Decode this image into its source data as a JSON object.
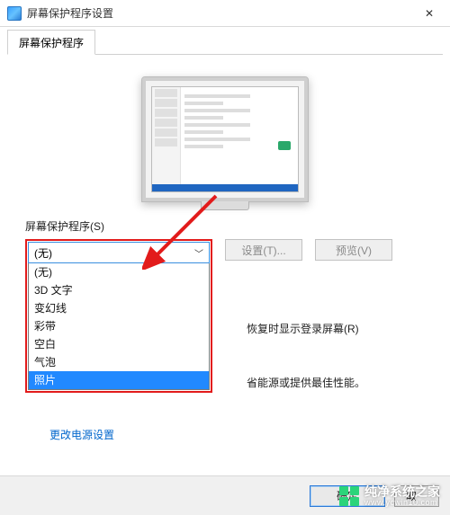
{
  "window": {
    "title": "屏幕保护程序设置",
    "close": "✕"
  },
  "tab": {
    "label": "屏幕保护程序"
  },
  "section_label": "屏幕保护程序(S)",
  "combo": {
    "selected": "(无)",
    "options": [
      "(无)",
      "3D 文字",
      "变幻线",
      "彩带",
      "空白",
      "气泡",
      "照片"
    ]
  },
  "buttons": {
    "settings": "设置(T)...",
    "preview": "预览(V)"
  },
  "partial": {
    "resume": "恢复时显示登录屏幕(R)",
    "power": "省能源或提供最佳性能。"
  },
  "link": {
    "power_settings": "更改电源设置"
  },
  "dialog": {
    "ok": "确定",
    "cancel": "取"
  },
  "watermark": {
    "brand": "纯净系统之家",
    "url": "www.ycwin10.com"
  }
}
